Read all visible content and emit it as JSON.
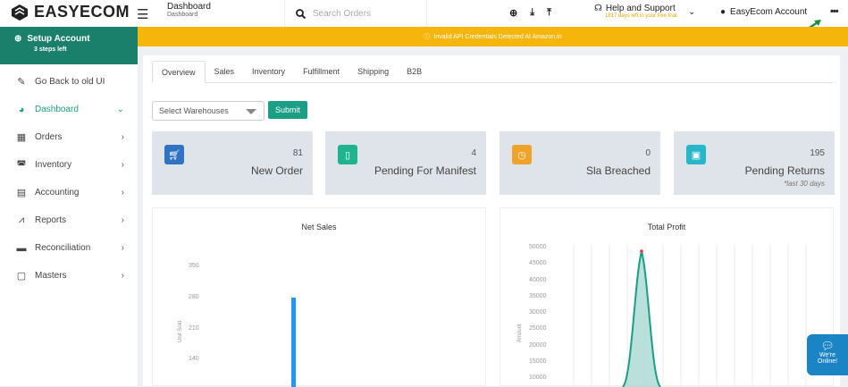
{
  "header": {
    "brand": "EASYECOM",
    "title": "Dashboard",
    "subtitle": "Dashboard",
    "search_placeholder": "Search Orders",
    "help_label": "Help and Support",
    "trial_text": "1817 days left in your free trial",
    "account_label": "EasyEcom Account",
    "more_label": "•••"
  },
  "sidebar": {
    "setup_title": "Setup Account",
    "setup_sub": "3 steps left",
    "items": [
      {
        "label": "Go Back to old UI",
        "icon": "edit-icon"
      },
      {
        "label": "Dashboard",
        "icon": "dashboard-icon"
      },
      {
        "label": "Orders",
        "icon": "grid-icon"
      },
      {
        "label": "Inventory",
        "icon": "bag-icon"
      },
      {
        "label": "Accounting",
        "icon": "document-icon"
      },
      {
        "label": "Reports",
        "icon": "chart-icon"
      },
      {
        "label": "Reconciliation",
        "icon": "wallet-icon"
      },
      {
        "label": "Masters",
        "icon": "square-icon"
      }
    ]
  },
  "alert": {
    "text": "Invalid API Credentials Detected At Amazon.in"
  },
  "tabs": [
    "Overview",
    "Sales",
    "Inventory",
    "Fulfillment",
    "Shipping",
    "B2B"
  ],
  "filter": {
    "warehouse_placeholder": "Select Warehouses",
    "submit_label": "Submit"
  },
  "stats": [
    {
      "value": "81",
      "label": "New Order",
      "color": "#2f73c2",
      "icon": "cart-icon"
    },
    {
      "value": "4",
      "label": "Pending For Manifest",
      "color": "#1fb48e",
      "icon": "file-icon"
    },
    {
      "value": "0",
      "label": "Sla Breached",
      "color": "#f0a32a",
      "icon": "clock-icon"
    },
    {
      "value": "195",
      "label": "Pending Returns",
      "color": "#29b6c8",
      "icon": "box-icon",
      "note": "*last 30 days"
    }
  ],
  "net_sales": {
    "title": "Net Sales",
    "ylabel": "Unit Sold",
    "ticks": [
      "350",
      "280",
      "210",
      "140"
    ]
  },
  "total_profit": {
    "title": "Total Profit",
    "ylabel": "Amount",
    "ticks": [
      "50000",
      "45000",
      "40000",
      "35000",
      "30000",
      "25000",
      "20000",
      "15000",
      "10000"
    ]
  },
  "chat": {
    "line1": "We're",
    "line2": "Online!"
  },
  "colors": {
    "primary": "#1a9e86",
    "alert": "#f5b50b",
    "bar": "#2196f3"
  }
}
